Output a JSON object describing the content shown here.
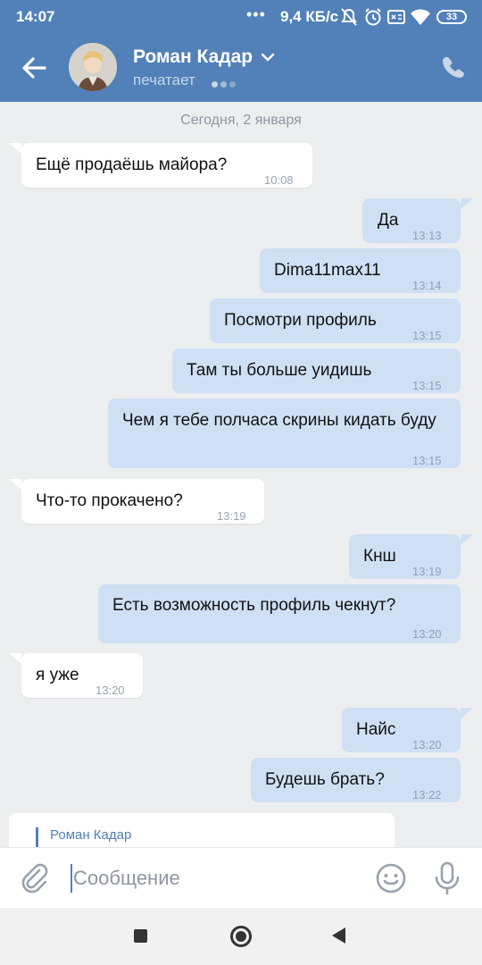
{
  "status_bar": {
    "time": "14:07",
    "dots": "•••",
    "speed": "9,4 КБ/с",
    "battery": "33"
  },
  "header": {
    "contact_name": "Роман Кадар",
    "status": "печатает"
  },
  "chat": {
    "date": "Сегодня, 2 января",
    "messages": [
      {
        "dir": "in",
        "text": "Ещё продаёшь майора?",
        "time": "10:08"
      },
      {
        "dir": "out",
        "text": "Да",
        "time": "13:13"
      },
      {
        "dir": "out",
        "text": "Dima11max11",
        "time": "13:14"
      },
      {
        "dir": "out",
        "text": "Посмотри профиль",
        "time": "13:15"
      },
      {
        "dir": "out",
        "text": "Там ты больше уидишь",
        "time": "13:15"
      },
      {
        "dir": "out",
        "text": "Чем я тебе полчаса скрины кидать буду",
        "time": "13:15"
      },
      {
        "dir": "in",
        "text": "Что-то прокачено?",
        "time": "13:19"
      },
      {
        "dir": "out",
        "text": "Кнш",
        "time": "13:19"
      },
      {
        "dir": "out",
        "text": "Есть возможность профиль чекнут?",
        "time": "13:20"
      },
      {
        "dir": "in",
        "text": "я уже",
        "time": "13:20"
      },
      {
        "dir": "out",
        "text": "Найс",
        "time": "13:20"
      },
      {
        "dir": "out",
        "text": "Будешь брать?",
        "time": "13:22"
      }
    ],
    "reply_preview_name": "Роман Кадар"
  },
  "composer": {
    "placeholder": "Сообщение"
  },
  "colors": {
    "header": "#5181b8",
    "background": "#edeef0",
    "outgoing_bubble": "#cfe0f5",
    "incoming_bubble": "#ffffff"
  }
}
